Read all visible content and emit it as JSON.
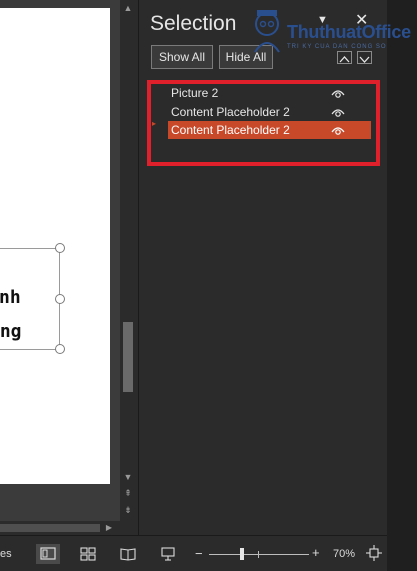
{
  "pane": {
    "title": "Selection",
    "menu_glyph": "▼",
    "close_glyph": "✕",
    "show_all": "Show All",
    "hide_all": "Hide All",
    "items": [
      {
        "label": "Picture 2",
        "selected": false,
        "visible": true
      },
      {
        "label": "Content Placeholder 2",
        "selected": false,
        "visible": true
      },
      {
        "label": "Content Placeholder 2",
        "selected": true,
        "visible": true
      }
    ]
  },
  "slide": {
    "text_line1": "nh",
    "text_line2": "ợng"
  },
  "logo": {
    "text": "ThuthuatOffice",
    "subtext": "TRI KY CUA DAN CONG SO"
  },
  "statusbar": {
    "notes_label": "es",
    "zoom_minus": "−",
    "zoom_plus": "+",
    "zoom_level": "70%",
    "zoom_fraction": 0.33
  },
  "colors": {
    "accent": "#c8492a",
    "highlight_border": "#e0202a",
    "pane_bg": "#2b2b2b",
    "logo_blue": "#2a4f8f"
  },
  "icons": {
    "visibility": "eye-icon",
    "normal_view": "normal-view-icon",
    "slide_sorter": "slide-sorter-icon",
    "reading_view": "reading-view-icon",
    "slide_show": "slide-show-icon",
    "fit_slide": "fit-slide-icon"
  }
}
